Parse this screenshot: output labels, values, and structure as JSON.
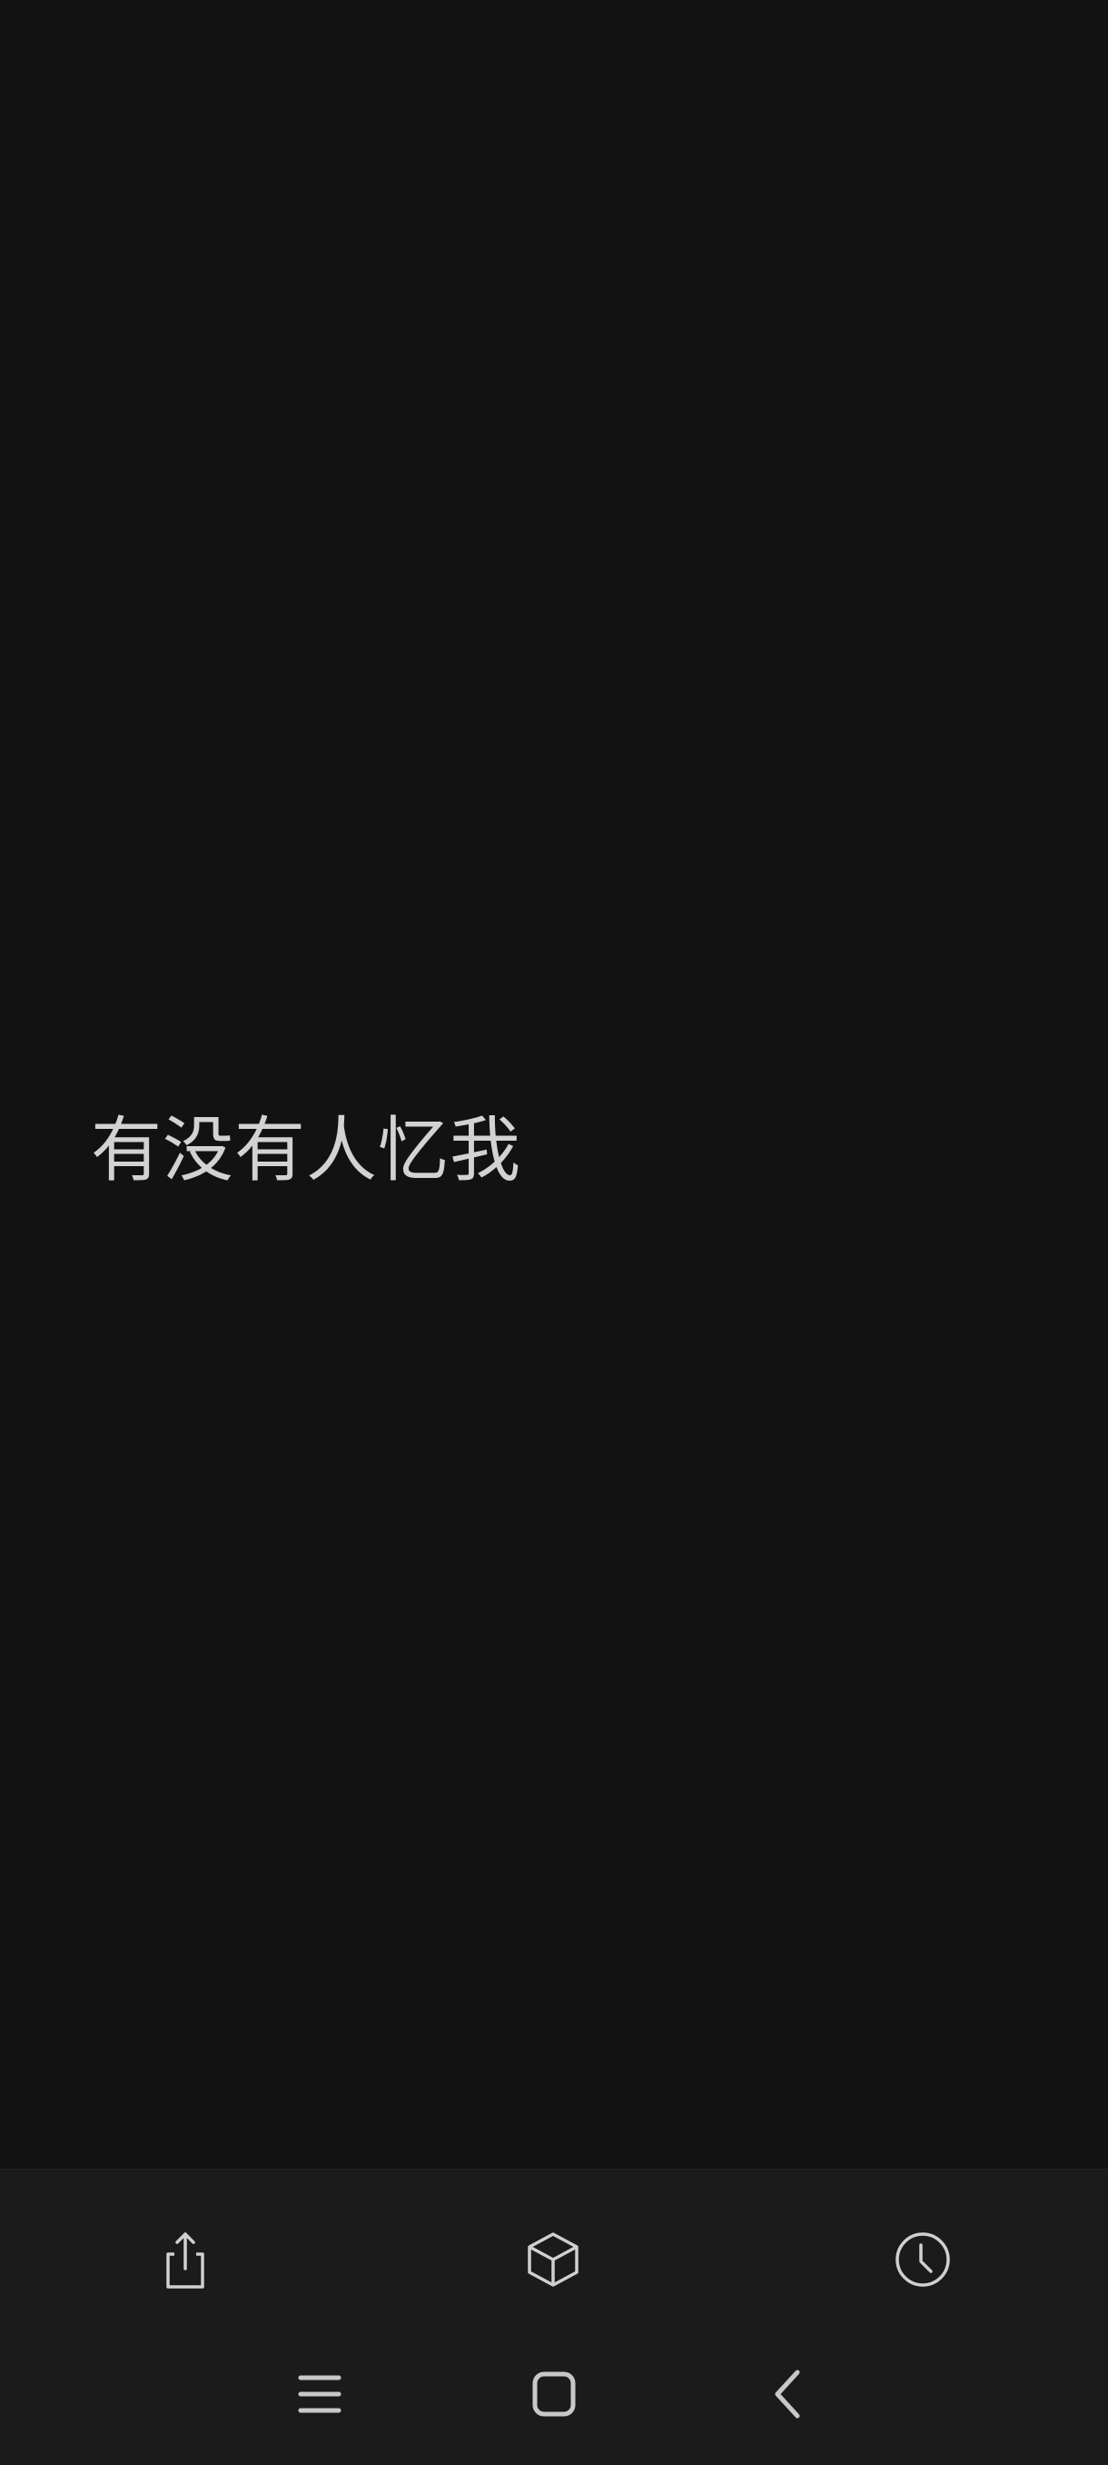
{
  "note": {
    "text": "有没有人忆我"
  },
  "toolbar": {
    "items": [
      {
        "name": "share",
        "icon": "share-icon"
      },
      {
        "name": "cube",
        "icon": "cube-icon"
      },
      {
        "name": "history",
        "icon": "clock-icon"
      }
    ]
  },
  "system_nav": {
    "items": [
      {
        "name": "recents",
        "icon": "recents-icon"
      },
      {
        "name": "home",
        "icon": "home-icon"
      },
      {
        "name": "back",
        "icon": "back-icon"
      }
    ]
  },
  "colors": {
    "background": "#121212",
    "bar_background": "#1b1b1b",
    "text": "#d2d2d2",
    "icon": "#d0d0d0"
  }
}
